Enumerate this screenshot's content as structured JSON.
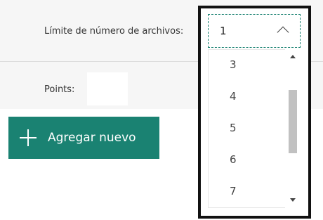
{
  "settings": {
    "file_limit_label": "Límite de número de archivos:",
    "points_label": "Points:",
    "points_value": ""
  },
  "dropdown": {
    "selected_value": "1",
    "options": [
      "3",
      "4",
      "5",
      "6",
      "7"
    ],
    "open": true
  },
  "actions": {
    "add_new_label": "Agregar nuevo"
  },
  "colors": {
    "accent": "#1a8272",
    "panel_background": "#f6f6f6",
    "frame_border": "#111111"
  },
  "icons": {
    "add": "plus-icon",
    "select": "chevron-up-icon",
    "scroll_up": "triangle-up-icon",
    "scroll_down": "triangle-down-icon"
  }
}
